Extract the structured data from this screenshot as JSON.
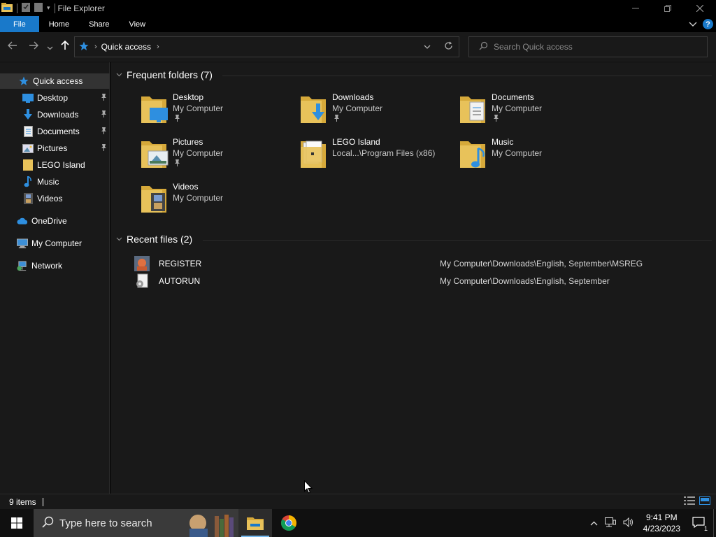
{
  "window": {
    "title": "File Explorer"
  },
  "ribbon": {
    "tabs": [
      "File",
      "Home",
      "Share",
      "View"
    ]
  },
  "address": {
    "location": "Quick access"
  },
  "search": {
    "placeholder": "Search Quick access"
  },
  "sidebar": {
    "items": [
      {
        "label": "Quick access",
        "icon": "star-icon",
        "pinned": false,
        "selected": true
      },
      {
        "label": "Desktop",
        "icon": "desktop-icon",
        "pinned": true
      },
      {
        "label": "Downloads",
        "icon": "download-arrow-icon",
        "pinned": true
      },
      {
        "label": "Documents",
        "icon": "document-icon",
        "pinned": true
      },
      {
        "label": "Pictures",
        "icon": "picture-icon",
        "pinned": true
      },
      {
        "label": "LEGO Island",
        "icon": "folder-icon",
        "pinned": false
      },
      {
        "label": "Music",
        "icon": "music-note-icon",
        "pinned": false
      },
      {
        "label": "Videos",
        "icon": "film-icon",
        "pinned": false
      },
      {
        "label": "OneDrive",
        "icon": "cloud-icon",
        "pinned": false
      },
      {
        "label": "My Computer",
        "icon": "computer-icon",
        "pinned": false
      },
      {
        "label": "Network",
        "icon": "network-icon",
        "pinned": false
      }
    ]
  },
  "frequent": {
    "header": "Frequent folders (7)",
    "folders": [
      {
        "name": "Desktop",
        "location": "My Computer",
        "pinned": true
      },
      {
        "name": "Downloads",
        "location": "My Computer",
        "pinned": true
      },
      {
        "name": "Documents",
        "location": "My Computer",
        "pinned": true
      },
      {
        "name": "Pictures",
        "location": "My Computer",
        "pinned": true
      },
      {
        "name": "LEGO Island",
        "location": "Local...\\Program Files (x86)",
        "pinned": false
      },
      {
        "name": "Music",
        "location": "My Computer",
        "pinned": false
      },
      {
        "name": "Videos",
        "location": "My Computer",
        "pinned": false
      }
    ]
  },
  "recent": {
    "header": "Recent files (2)",
    "files": [
      {
        "name": "REGISTER",
        "path": "My Computer\\Downloads\\English, September\\MSREG"
      },
      {
        "name": "AUTORUN",
        "path": "My Computer\\Downloads\\English, September"
      }
    ]
  },
  "status": {
    "count": "9 items"
  },
  "taskbar": {
    "search_placeholder": "Type here to search",
    "time": "9:41 PM",
    "date": "4/23/2023",
    "notification_count": "1"
  },
  "colors": {
    "accent": "#1979ca",
    "folder": "#e8c25a",
    "background": "#191919"
  }
}
